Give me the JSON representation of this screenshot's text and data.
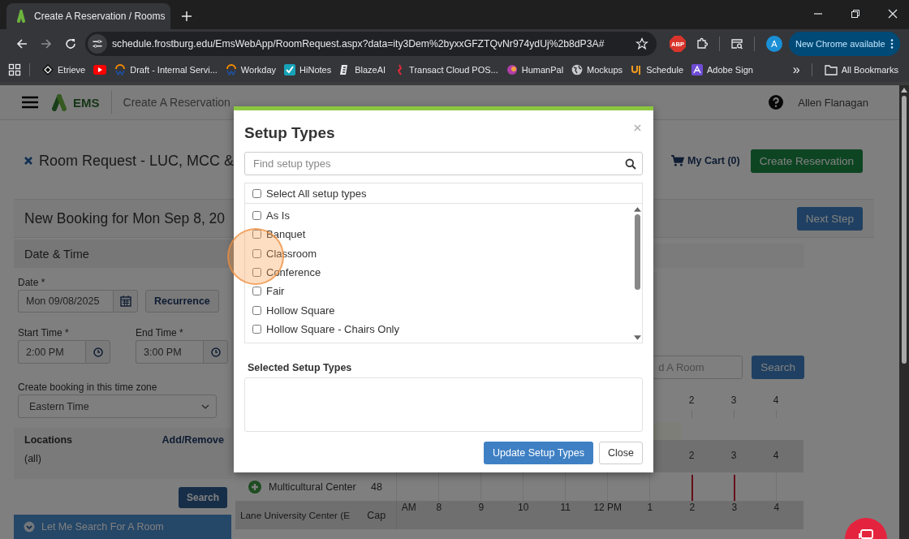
{
  "browser": {
    "tab": {
      "title": "Create A Reservation / Rooms"
    },
    "address": "schedule.frostburg.edu/EmsWebApp/RoomRequest.aspx?data=ity3Dem%2byxxGFZTQvNr974ydUj%2b8dP3A#",
    "extension_badge": "ABP",
    "profile": "A",
    "update_button": "New Chrome available",
    "bookmarks": [
      {
        "kind": "diamond",
        "label": "Etrieve"
      },
      {
        "kind": "video"
      },
      {
        "kind": "arc",
        "label": "Draft - Internal Servi..."
      },
      {
        "kind": "arc",
        "label": "Workday"
      },
      {
        "kind": "check",
        "label": "HiNotes"
      },
      {
        "kind": "letter",
        "label": "BlazeAI"
      },
      {
        "kind": "flame",
        "label": "Transact Cloud POS..."
      },
      {
        "kind": "blob",
        "label": "HumanPal"
      },
      {
        "kind": "globe",
        "label": "Mockups"
      },
      {
        "kind": "fork",
        "label": "Schedule"
      },
      {
        "kind": "pdf",
        "label": "Adobe Sign"
      }
    ],
    "overflow": "»",
    "all_bookmarks": "All Bookmarks"
  },
  "header": {
    "app_name": "EMS",
    "page_title": "Create A Reservation",
    "user": "Allen Flanagan"
  },
  "request": {
    "title": "Room Request - LUC, MCC &",
    "cart": "My Cart (0)",
    "create_button": "Create Reservation"
  },
  "booking": {
    "title": "New Booking for Mon Sep 8, 20",
    "next_button": "Next Step"
  },
  "date_time": {
    "heading": "Date & Time",
    "date_label": "Date *",
    "date": "Mon 09/08/2025",
    "recurrence_button": "Recurrence",
    "start_label": "Start Time *",
    "start": "2:00 PM",
    "end_label": "End Time *",
    "end": "3:00 PM",
    "timezone_label": "Create booking in this time zone",
    "timezone": "Eastern Time"
  },
  "locations": {
    "heading": "Locations",
    "edit_link": "Add/Remove",
    "value": "(all)",
    "search_button": "Search",
    "search_room_bar": "Let Me Search For A Room"
  },
  "room_search": {
    "placeholder": "d A Room",
    "search_button": "Search"
  },
  "timeline": {
    "rows": [
      {
        "kind": "hours",
        "hours": [
          "2",
          "3",
          "4"
        ]
      },
      {
        "kind": "band"
      },
      {
        "kind": "hours_band",
        "hours": [
          "2",
          "3",
          "4"
        ]
      },
      {
        "kind": "room",
        "name": "Multicultural Center",
        "capacity": "48"
      },
      {
        "kind": "building",
        "name": "Lane University Center (E",
        "capacity": "Cap",
        "hours": [
          "AM",
          "8",
          "9",
          "10",
          "11",
          "12 PM",
          "1",
          "2",
          "3",
          "4"
        ]
      }
    ]
  },
  "dialog": {
    "title": "Setup Types",
    "search_placeholder": "Find setup types",
    "select_all": {
      "label": "Select All setup types",
      "checked": false
    },
    "options": [
      {
        "label": "As Is",
        "checked": false
      },
      {
        "label": "Banquet",
        "checked": false
      },
      {
        "label": "Classroom",
        "checked": false
      },
      {
        "label": "Conference",
        "checked": false
      },
      {
        "label": "Fair",
        "checked": false
      },
      {
        "label": "Hollow Square",
        "checked": false
      },
      {
        "label": "Hollow Square - Chairs Only",
        "checked": false
      }
    ],
    "selected_heading": "Selected Setup Types",
    "update_button": "Update Setup Types",
    "close_button": "Close"
  }
}
